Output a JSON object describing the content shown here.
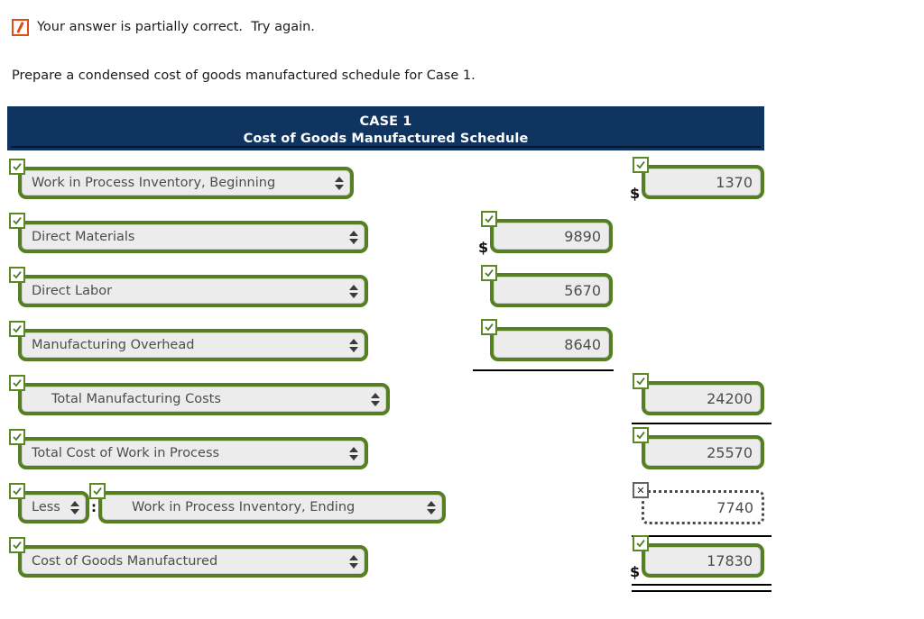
{
  "feedback": {
    "icon": "partial-correct-icon",
    "text": "Your answer is partially correct.  Try again."
  },
  "prompt": "Prepare a condensed cost of goods manufactured schedule for Case 1.",
  "schedule": {
    "header_line1": "CASE 1",
    "header_line2": "Cost of Goods Manufactured Schedule",
    "colors": {
      "header_bg": "#0f3460",
      "correct_green": "#558021",
      "incorrect_gray": "#4a4a4a",
      "field_bg": "#ececec",
      "partial_orange": "#e04e17"
    },
    "colon": ":",
    "dollar": "$",
    "rows": [
      {
        "label": "Work in Process Inventory, Beginning",
        "label_status": "correct",
        "amount": "1370",
        "amount_status": "correct",
        "amount_column": "right",
        "dollar": true
      },
      {
        "label": "Direct Materials",
        "label_status": "correct",
        "amount": "9890",
        "amount_status": "correct",
        "amount_column": "middle",
        "dollar": true
      },
      {
        "label": "Direct Labor",
        "label_status": "correct",
        "amount": "5670",
        "amount_status": "correct",
        "amount_column": "middle",
        "dollar": false
      },
      {
        "label": "Manufacturing Overhead",
        "label_status": "correct",
        "amount": "8640",
        "amount_status": "correct",
        "amount_column": "middle",
        "dollar": false
      },
      {
        "label": "Total Manufacturing Costs",
        "label_status": "correct",
        "amount": "24200",
        "amount_status": "correct",
        "amount_column": "right",
        "dollar": false
      },
      {
        "label": "Total Cost of Work in Process",
        "label_status": "correct",
        "amount": "25570",
        "amount_status": "correct",
        "amount_column": "right",
        "dollar": false
      },
      {
        "prefix_label": "Less",
        "prefix_status": "correct",
        "label": "Work in Process Inventory, Ending",
        "label_status": "correct",
        "amount": "7740",
        "amount_status": "incorrect",
        "amount_column": "right",
        "dollar": false
      },
      {
        "label": "Cost of Goods Manufactured",
        "label_status": "correct",
        "amount": "17830",
        "amount_status": "correct",
        "amount_column": "right",
        "dollar": true
      }
    ]
  }
}
